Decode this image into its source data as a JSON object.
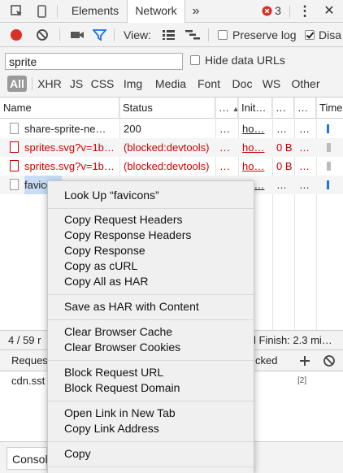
{
  "tabbar": {
    "tabs": [
      "Elements",
      "Network"
    ],
    "active_tab": "Network",
    "more_glyph": "»",
    "error_count": "3",
    "menu_glyph": "⋮",
    "close_glyph": "✕",
    "error_color": "#d93025"
  },
  "toolbar": {
    "view_label": "View:",
    "preserve_log_label": "Preserve log",
    "disable_label": "Disa",
    "preserve_log_checked": false,
    "disable_checked": true,
    "record_color": "#d93025",
    "filter_color": "#1a73e8"
  },
  "filter": {
    "value": "sprite",
    "hide_data_urls_label": "Hide data URLs",
    "types": [
      "All",
      "XHR",
      "JS",
      "CSS",
      "Img",
      "Media",
      "Font",
      "Doc",
      "WS",
      "Other"
    ],
    "active_type": "All"
  },
  "table": {
    "headers": [
      "Name",
      "Status",
      "…",
      "Init…",
      "…",
      "…",
      "Timel"
    ],
    "rows": [
      {
        "name": "share-sprite-ne…",
        "status": "200",
        "type": "…",
        "initiator": "ho…",
        "size": "…",
        "time": "…",
        "blocked": false
      },
      {
        "name": "sprites.svg?v=1b…",
        "status": "(blocked:devtools)",
        "type": "…",
        "initiator": "ho…",
        "size": "0 B",
        "time": "…",
        "blocked": true
      },
      {
        "name": "sprites.svg?v=1b…",
        "status": "(blocked:devtools)",
        "type": "…",
        "initiator": "ho…",
        "size": "0 B",
        "time": "…",
        "blocked": true
      },
      {
        "name": "favico",
        "status": "200",
        "type": "…",
        "initiator": "ho…",
        "size": "…",
        "time": "…",
        "blocked": false
      }
    ]
  },
  "statusbar": {
    "requests": "4 / 59 r",
    "finish": "l  Finish: 2.3 mi…"
  },
  "lower": {
    "header_left": "Reques",
    "header_right": "cked",
    "row_text": "cdn.sst",
    "row_count": "[2]"
  },
  "drawer": {
    "tab_label": "Consol"
  },
  "context_menu": {
    "groups": [
      [
        "Look Up “favicons”"
      ],
      [
        "Copy Request Headers",
        "Copy Response Headers",
        "Copy Response",
        "Copy as cURL",
        "Copy All as HAR"
      ],
      [
        "Save as HAR with Content"
      ],
      [
        "Clear Browser Cache",
        "Clear Browser Cookies"
      ],
      [
        "Block Request URL",
        "Block Request Domain"
      ],
      [
        "Open Link in New Tab",
        "Copy Link Address"
      ],
      [
        "Copy"
      ]
    ]
  }
}
